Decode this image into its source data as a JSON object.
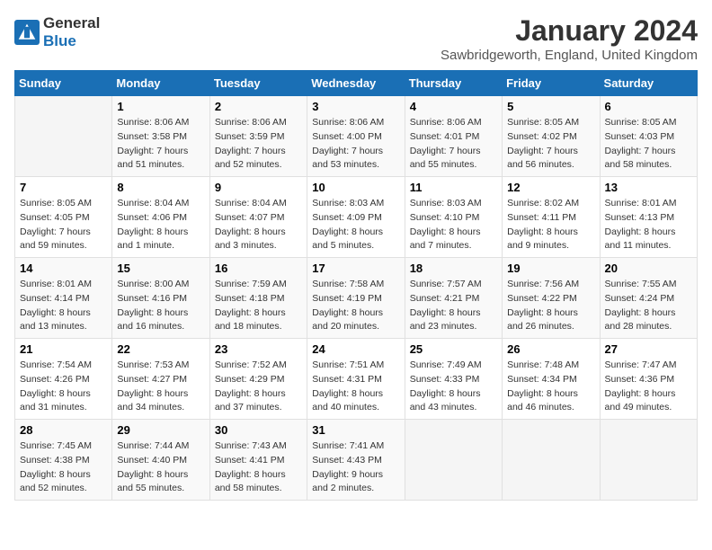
{
  "logo": {
    "general": "General",
    "blue": "Blue"
  },
  "title": "January 2024",
  "location": "Sawbridgeworth, England, United Kingdom",
  "headers": [
    "Sunday",
    "Monday",
    "Tuesday",
    "Wednesday",
    "Thursday",
    "Friday",
    "Saturday"
  ],
  "weeks": [
    [
      {
        "day": "",
        "info": ""
      },
      {
        "day": "1",
        "info": "Sunrise: 8:06 AM\nSunset: 3:58 PM\nDaylight: 7 hours\nand 51 minutes."
      },
      {
        "day": "2",
        "info": "Sunrise: 8:06 AM\nSunset: 3:59 PM\nDaylight: 7 hours\nand 52 minutes."
      },
      {
        "day": "3",
        "info": "Sunrise: 8:06 AM\nSunset: 4:00 PM\nDaylight: 7 hours\nand 53 minutes."
      },
      {
        "day": "4",
        "info": "Sunrise: 8:06 AM\nSunset: 4:01 PM\nDaylight: 7 hours\nand 55 minutes."
      },
      {
        "day": "5",
        "info": "Sunrise: 8:05 AM\nSunset: 4:02 PM\nDaylight: 7 hours\nand 56 minutes."
      },
      {
        "day": "6",
        "info": "Sunrise: 8:05 AM\nSunset: 4:03 PM\nDaylight: 7 hours\nand 58 minutes."
      }
    ],
    [
      {
        "day": "7",
        "info": "Sunrise: 8:05 AM\nSunset: 4:05 PM\nDaylight: 7 hours\nand 59 minutes."
      },
      {
        "day": "8",
        "info": "Sunrise: 8:04 AM\nSunset: 4:06 PM\nDaylight: 8 hours\nand 1 minute."
      },
      {
        "day": "9",
        "info": "Sunrise: 8:04 AM\nSunset: 4:07 PM\nDaylight: 8 hours\nand 3 minutes."
      },
      {
        "day": "10",
        "info": "Sunrise: 8:03 AM\nSunset: 4:09 PM\nDaylight: 8 hours\nand 5 minutes."
      },
      {
        "day": "11",
        "info": "Sunrise: 8:03 AM\nSunset: 4:10 PM\nDaylight: 8 hours\nand 7 minutes."
      },
      {
        "day": "12",
        "info": "Sunrise: 8:02 AM\nSunset: 4:11 PM\nDaylight: 8 hours\nand 9 minutes."
      },
      {
        "day": "13",
        "info": "Sunrise: 8:01 AM\nSunset: 4:13 PM\nDaylight: 8 hours\nand 11 minutes."
      }
    ],
    [
      {
        "day": "14",
        "info": "Sunrise: 8:01 AM\nSunset: 4:14 PM\nDaylight: 8 hours\nand 13 minutes."
      },
      {
        "day": "15",
        "info": "Sunrise: 8:00 AM\nSunset: 4:16 PM\nDaylight: 8 hours\nand 16 minutes."
      },
      {
        "day": "16",
        "info": "Sunrise: 7:59 AM\nSunset: 4:18 PM\nDaylight: 8 hours\nand 18 minutes."
      },
      {
        "day": "17",
        "info": "Sunrise: 7:58 AM\nSunset: 4:19 PM\nDaylight: 8 hours\nand 20 minutes."
      },
      {
        "day": "18",
        "info": "Sunrise: 7:57 AM\nSunset: 4:21 PM\nDaylight: 8 hours\nand 23 minutes."
      },
      {
        "day": "19",
        "info": "Sunrise: 7:56 AM\nSunset: 4:22 PM\nDaylight: 8 hours\nand 26 minutes."
      },
      {
        "day": "20",
        "info": "Sunrise: 7:55 AM\nSunset: 4:24 PM\nDaylight: 8 hours\nand 28 minutes."
      }
    ],
    [
      {
        "day": "21",
        "info": "Sunrise: 7:54 AM\nSunset: 4:26 PM\nDaylight: 8 hours\nand 31 minutes."
      },
      {
        "day": "22",
        "info": "Sunrise: 7:53 AM\nSunset: 4:27 PM\nDaylight: 8 hours\nand 34 minutes."
      },
      {
        "day": "23",
        "info": "Sunrise: 7:52 AM\nSunset: 4:29 PM\nDaylight: 8 hours\nand 37 minutes."
      },
      {
        "day": "24",
        "info": "Sunrise: 7:51 AM\nSunset: 4:31 PM\nDaylight: 8 hours\nand 40 minutes."
      },
      {
        "day": "25",
        "info": "Sunrise: 7:49 AM\nSunset: 4:33 PM\nDaylight: 8 hours\nand 43 minutes."
      },
      {
        "day": "26",
        "info": "Sunrise: 7:48 AM\nSunset: 4:34 PM\nDaylight: 8 hours\nand 46 minutes."
      },
      {
        "day": "27",
        "info": "Sunrise: 7:47 AM\nSunset: 4:36 PM\nDaylight: 8 hours\nand 49 minutes."
      }
    ],
    [
      {
        "day": "28",
        "info": "Sunrise: 7:45 AM\nSunset: 4:38 PM\nDaylight: 8 hours\nand 52 minutes."
      },
      {
        "day": "29",
        "info": "Sunrise: 7:44 AM\nSunset: 4:40 PM\nDaylight: 8 hours\nand 55 minutes."
      },
      {
        "day": "30",
        "info": "Sunrise: 7:43 AM\nSunset: 4:41 PM\nDaylight: 8 hours\nand 58 minutes."
      },
      {
        "day": "31",
        "info": "Sunrise: 7:41 AM\nSunset: 4:43 PM\nDaylight: 9 hours\nand 2 minutes."
      },
      {
        "day": "",
        "info": ""
      },
      {
        "day": "",
        "info": ""
      },
      {
        "day": "",
        "info": ""
      }
    ]
  ]
}
